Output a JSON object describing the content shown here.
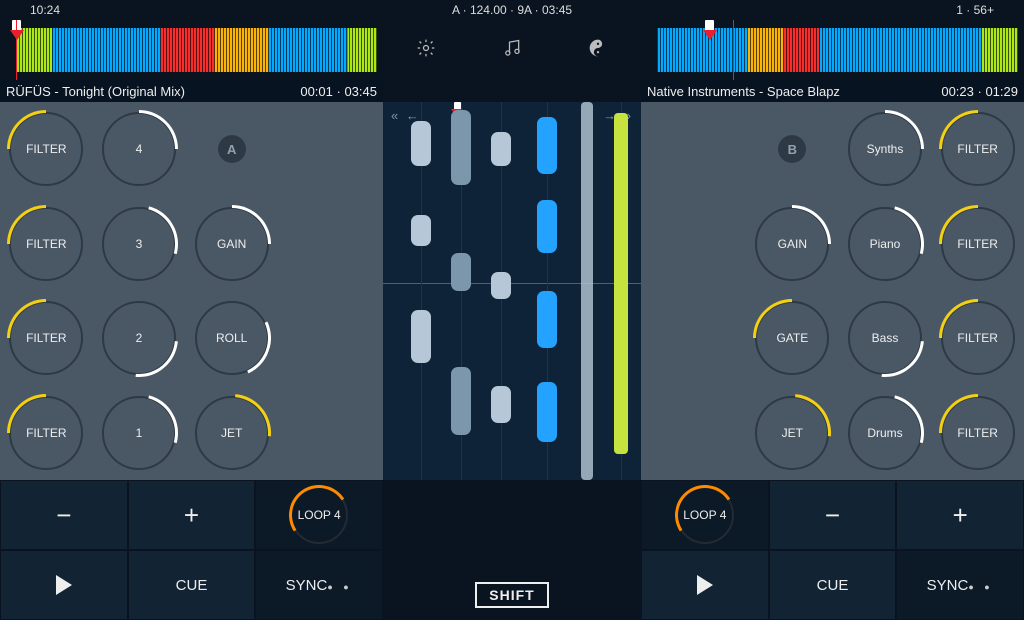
{
  "status": {
    "time": "10:24",
    "center": "A · 124.00 · 9A · 03:45",
    "right": "1 · 56+"
  },
  "toolbar": {
    "settings": "settings",
    "music": "music",
    "balance": "balance"
  },
  "deckA": {
    "artist_title": "RÜFÜS - Tonight (Original Mix)",
    "elapsed": "00:01",
    "total": "03:45",
    "badge": "A",
    "knobs": [
      [
        "FILTER",
        "4",
        ""
      ],
      [
        "FILTER",
        "3",
        "GAIN"
      ],
      [
        "FILTER",
        "2",
        "ROLL"
      ],
      [
        "FILTER",
        "1",
        "JET"
      ]
    ]
  },
  "deckB": {
    "artist_title": "Native Instruments - Space Blapz",
    "elapsed": "00:23",
    "total": "01:29",
    "badge": "B",
    "knobs": [
      [
        "",
        "Synths",
        "FILTER"
      ],
      [
        "GAIN",
        "Piano",
        "FILTER"
      ],
      [
        "GATE",
        "Bass",
        "FILTER"
      ],
      [
        "JET",
        "Drums",
        "FILTER"
      ]
    ]
  },
  "transport": {
    "minus": "−",
    "plus": "+",
    "loop": "LOOP 4",
    "play": "play",
    "cue": "CUE",
    "sync": "SYNC",
    "shift": "SHIFT"
  }
}
